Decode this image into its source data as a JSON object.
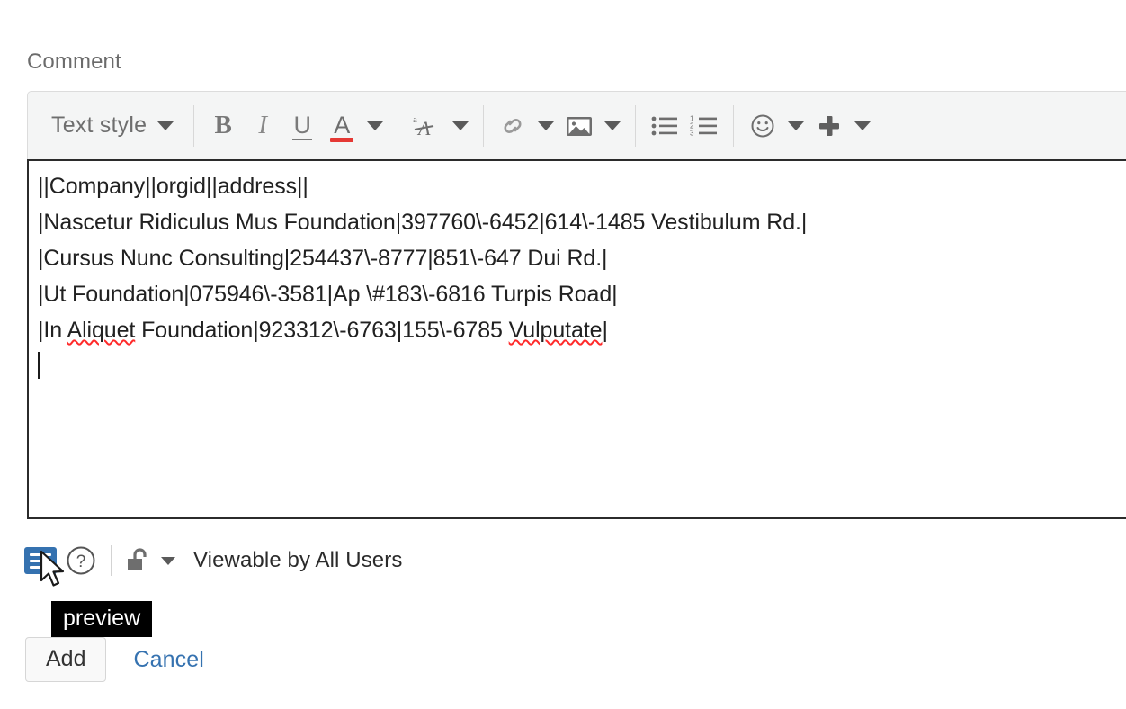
{
  "form": {
    "field_label": "Comment"
  },
  "toolbar": {
    "text_style_label": "Text style",
    "bold_label": "B",
    "italic_label": "I",
    "underline_label": "U",
    "text_color_label": "A",
    "icons": {
      "text_style_dropdown": "chevron-down-icon",
      "bold": "bold-icon",
      "italic": "italic-icon",
      "underline": "underline-icon",
      "text_color": "text-color-icon",
      "text_color_dropdown": "chevron-down-icon",
      "text_effects": "text-effects-icon",
      "text_effects_dropdown": "chevron-down-icon",
      "link": "link-icon",
      "link_dropdown": "chevron-down-icon",
      "image": "image-icon",
      "image_dropdown": "chevron-down-icon",
      "bullet_list": "bullet-list-icon",
      "numbered_list": "numbered-list-icon",
      "emoji": "emoji-icon",
      "emoji_dropdown": "chevron-down-icon",
      "insert": "plus-icon",
      "insert_dropdown": "chevron-down-icon"
    }
  },
  "editor": {
    "lines": [
      "||Company||orgid||address||",
      "|Nascetur Ridiculus Mus Foundation|397760\\-6452|614\\-1485 Vestibulum Rd.|",
      "|Cursus Nunc Consulting|254437\\-8777|851\\-647 Dui Rd.|",
      "|Ut Foundation|075946\\-3581|Ap \\#183\\-6816 Turpis Road|"
    ],
    "line5_parts": {
      "a": "|In ",
      "b_misspelled": "Aliquet",
      "c": " Foundation|923312\\-6763|155\\-6785 ",
      "d_misspelled": "Vulputate",
      "e": "|"
    }
  },
  "footer": {
    "preview_icon": "preview-icon",
    "help_icon": "help-circle-icon",
    "lock_icon": "unlocked-padlock-icon",
    "lock_dropdown_icon": "chevron-down-icon",
    "visibility_text": "Viewable by All Users"
  },
  "tooltip": {
    "text": "preview"
  },
  "actions": {
    "add_label": "Add",
    "cancel_label": "Cancel"
  },
  "colors": {
    "accent_blue": "#3572b0",
    "link_blue": "#3572b0",
    "text_color_swatch": "#e53935",
    "spellcheck_underline": "#ff2a2a",
    "tooltip_bg": "#000000",
    "toolbar_bg": "#f4f5f5",
    "editor_border": "#2b2b2b"
  }
}
